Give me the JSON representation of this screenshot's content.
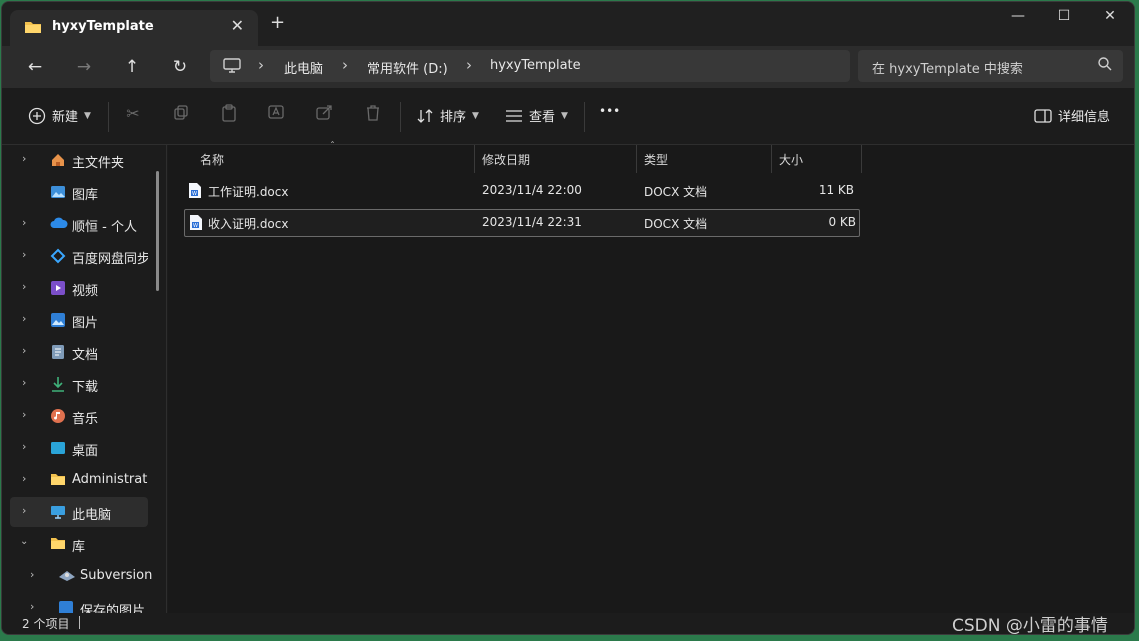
{
  "tab": {
    "title": "hyxyTemplate",
    "close": "✕",
    "new": "+"
  },
  "window": {
    "minimize": "—",
    "maximize": "☐",
    "close": "✕"
  },
  "nav": {
    "back": "←",
    "forward": "→",
    "up": "↑",
    "refresh": "↻",
    "breadcrumb": [
      "此电脑",
      "常用软件 (D:)",
      "hyxyTemplate"
    ],
    "search_placeholder": "在 hyxyTemplate 中搜索"
  },
  "toolbar": {
    "new_label": "新建",
    "sort_label": "排序",
    "view_label": "查看",
    "more_label": "•••",
    "details_label": "详细信息"
  },
  "sidebar": {
    "items": [
      {
        "label": "主文件夹",
        "icon": "home-icon"
      },
      {
        "label": "图库",
        "icon": "gallery-icon"
      },
      {
        "label": "顺恒 - 个人",
        "icon": "onedrive-icon"
      },
      {
        "label": "百度网盘同步空间",
        "icon": "baidu-icon"
      },
      {
        "label": "视频",
        "icon": "video-icon"
      },
      {
        "label": "图片",
        "icon": "pictures-icon"
      },
      {
        "label": "文档",
        "icon": "documents-icon"
      },
      {
        "label": "下载",
        "icon": "download-icon"
      },
      {
        "label": "音乐",
        "icon": "music-icon"
      },
      {
        "label": "桌面",
        "icon": "desktop-icon"
      },
      {
        "label": "Administrator",
        "icon": "folder-icon"
      },
      {
        "label": "此电脑",
        "icon": "pc-icon"
      },
      {
        "label": "库",
        "icon": "folder-icon"
      },
      {
        "label": "Subversion",
        "icon": "subversion-icon"
      },
      {
        "label": "保存的图片",
        "icon": "saved-pictures-icon"
      }
    ]
  },
  "columns": {
    "name": "名称",
    "modified": "修改日期",
    "type": "类型",
    "size": "大小"
  },
  "files": [
    {
      "name": "工作证明.docx",
      "modified": "2023/11/4 22:00",
      "type": "DOCX 文档",
      "size": "11 KB"
    },
    {
      "name": "收入证明.docx",
      "modified": "2023/11/4 22:31",
      "type": "DOCX 文档",
      "size": "0 KB"
    }
  ],
  "status": {
    "count": "2 个项目"
  },
  "watermark": "CSDN @小雷的事情"
}
